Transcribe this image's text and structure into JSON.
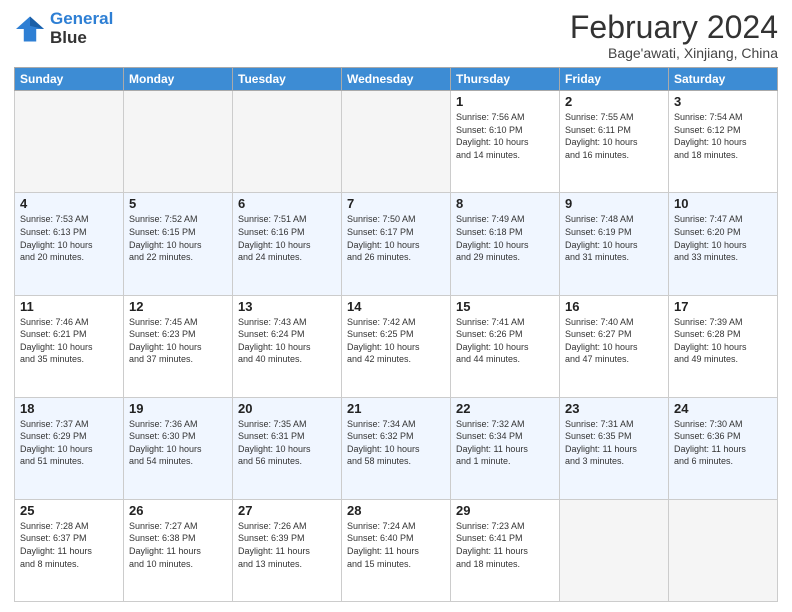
{
  "logo": {
    "line1": "General",
    "line2": "Blue"
  },
  "title": "February 2024",
  "subtitle": "Bage'awati, Xinjiang, China",
  "days_of_week": [
    "Sunday",
    "Monday",
    "Tuesday",
    "Wednesday",
    "Thursday",
    "Friday",
    "Saturday"
  ],
  "weeks": [
    [
      {
        "day": "",
        "info": ""
      },
      {
        "day": "",
        "info": ""
      },
      {
        "day": "",
        "info": ""
      },
      {
        "day": "",
        "info": ""
      },
      {
        "day": "1",
        "info": "Sunrise: 7:56 AM\nSunset: 6:10 PM\nDaylight: 10 hours\nand 14 minutes."
      },
      {
        "day": "2",
        "info": "Sunrise: 7:55 AM\nSunset: 6:11 PM\nDaylight: 10 hours\nand 16 minutes."
      },
      {
        "day": "3",
        "info": "Sunrise: 7:54 AM\nSunset: 6:12 PM\nDaylight: 10 hours\nand 18 minutes."
      }
    ],
    [
      {
        "day": "4",
        "info": "Sunrise: 7:53 AM\nSunset: 6:13 PM\nDaylight: 10 hours\nand 20 minutes."
      },
      {
        "day": "5",
        "info": "Sunrise: 7:52 AM\nSunset: 6:15 PM\nDaylight: 10 hours\nand 22 minutes."
      },
      {
        "day": "6",
        "info": "Sunrise: 7:51 AM\nSunset: 6:16 PM\nDaylight: 10 hours\nand 24 minutes."
      },
      {
        "day": "7",
        "info": "Sunrise: 7:50 AM\nSunset: 6:17 PM\nDaylight: 10 hours\nand 26 minutes."
      },
      {
        "day": "8",
        "info": "Sunrise: 7:49 AM\nSunset: 6:18 PM\nDaylight: 10 hours\nand 29 minutes."
      },
      {
        "day": "9",
        "info": "Sunrise: 7:48 AM\nSunset: 6:19 PM\nDaylight: 10 hours\nand 31 minutes."
      },
      {
        "day": "10",
        "info": "Sunrise: 7:47 AM\nSunset: 6:20 PM\nDaylight: 10 hours\nand 33 minutes."
      }
    ],
    [
      {
        "day": "11",
        "info": "Sunrise: 7:46 AM\nSunset: 6:21 PM\nDaylight: 10 hours\nand 35 minutes."
      },
      {
        "day": "12",
        "info": "Sunrise: 7:45 AM\nSunset: 6:23 PM\nDaylight: 10 hours\nand 37 minutes."
      },
      {
        "day": "13",
        "info": "Sunrise: 7:43 AM\nSunset: 6:24 PM\nDaylight: 10 hours\nand 40 minutes."
      },
      {
        "day": "14",
        "info": "Sunrise: 7:42 AM\nSunset: 6:25 PM\nDaylight: 10 hours\nand 42 minutes."
      },
      {
        "day": "15",
        "info": "Sunrise: 7:41 AM\nSunset: 6:26 PM\nDaylight: 10 hours\nand 44 minutes."
      },
      {
        "day": "16",
        "info": "Sunrise: 7:40 AM\nSunset: 6:27 PM\nDaylight: 10 hours\nand 47 minutes."
      },
      {
        "day": "17",
        "info": "Sunrise: 7:39 AM\nSunset: 6:28 PM\nDaylight: 10 hours\nand 49 minutes."
      }
    ],
    [
      {
        "day": "18",
        "info": "Sunrise: 7:37 AM\nSunset: 6:29 PM\nDaylight: 10 hours\nand 51 minutes."
      },
      {
        "day": "19",
        "info": "Sunrise: 7:36 AM\nSunset: 6:30 PM\nDaylight: 10 hours\nand 54 minutes."
      },
      {
        "day": "20",
        "info": "Sunrise: 7:35 AM\nSunset: 6:31 PM\nDaylight: 10 hours\nand 56 minutes."
      },
      {
        "day": "21",
        "info": "Sunrise: 7:34 AM\nSunset: 6:32 PM\nDaylight: 10 hours\nand 58 minutes."
      },
      {
        "day": "22",
        "info": "Sunrise: 7:32 AM\nSunset: 6:34 PM\nDaylight: 11 hours\nand 1 minute."
      },
      {
        "day": "23",
        "info": "Sunrise: 7:31 AM\nSunset: 6:35 PM\nDaylight: 11 hours\nand 3 minutes."
      },
      {
        "day": "24",
        "info": "Sunrise: 7:30 AM\nSunset: 6:36 PM\nDaylight: 11 hours\nand 6 minutes."
      }
    ],
    [
      {
        "day": "25",
        "info": "Sunrise: 7:28 AM\nSunset: 6:37 PM\nDaylight: 11 hours\nand 8 minutes."
      },
      {
        "day": "26",
        "info": "Sunrise: 7:27 AM\nSunset: 6:38 PM\nDaylight: 11 hours\nand 10 minutes."
      },
      {
        "day": "27",
        "info": "Sunrise: 7:26 AM\nSunset: 6:39 PM\nDaylight: 11 hours\nand 13 minutes."
      },
      {
        "day": "28",
        "info": "Sunrise: 7:24 AM\nSunset: 6:40 PM\nDaylight: 11 hours\nand 15 minutes."
      },
      {
        "day": "29",
        "info": "Sunrise: 7:23 AM\nSunset: 6:41 PM\nDaylight: 11 hours\nand 18 minutes."
      },
      {
        "day": "",
        "info": ""
      },
      {
        "day": "",
        "info": ""
      }
    ]
  ]
}
